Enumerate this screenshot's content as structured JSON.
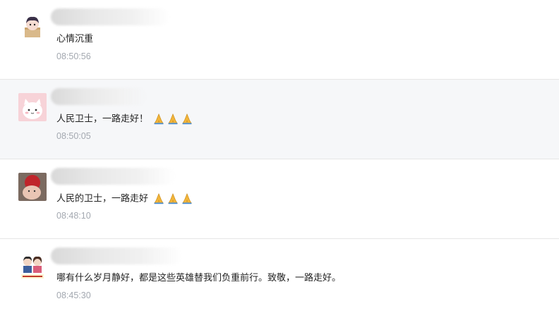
{
  "comments": [
    {
      "text": "心情沉重",
      "time": "08:50:56",
      "emoji_count": 0,
      "emoji_name": ""
    },
    {
      "text": "人民卫士，一路走好！",
      "time": "08:50:05",
      "emoji_count": 3,
      "emoji_name": "folded-hands-icon"
    },
    {
      "text": "人民的卫士，一路走好",
      "time": "08:48:10",
      "emoji_count": 3,
      "emoji_name": "folded-hands-icon"
    },
    {
      "text": "哪有什么岁月静好，都是这些英雄替我们负重前行。致敬，一路走好。",
      "time": "08:45:30",
      "emoji_count": 0,
      "emoji_name": ""
    }
  ],
  "colors": {
    "highlight_bg": "#f6f7f9",
    "timestamp": "#a3a8b0",
    "divider": "#e6e6e6"
  }
}
